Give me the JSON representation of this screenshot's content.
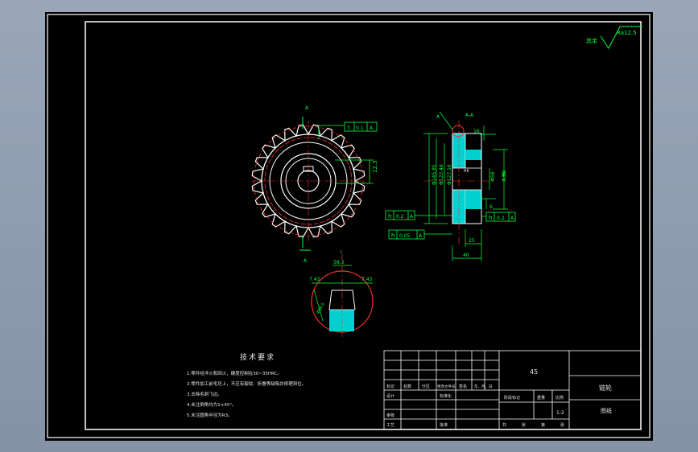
{
  "roughness": {
    "label": "其余",
    "value": "Ra12.5"
  },
  "front_view": {
    "section_label_top": "A",
    "section_label_bottom": "A",
    "tolerance": "t",
    "tol_value": "0.1",
    "tol_datum": "A",
    "dim_right": "12.3"
  },
  "side_view": {
    "section_mark": "A-A",
    "datum_mark": "A",
    "dims": [
      "Φ145.85",
      "Φ122.48",
      "Φ127.16",
      "Φ58",
      "Φ35",
      "16",
      "60",
      "6",
      "25",
      "40",
      "R6"
    ],
    "tol_left_top": {
      "sym": "h",
      "value": "0.2",
      "datum": "A"
    },
    "tol_left_bottom": {
      "sym": "h",
      "value": "0.05",
      "datum": "A"
    },
    "tol_right": {
      "sym": "h",
      "value": "0.2",
      "datum": "A"
    }
  },
  "detail_view": {
    "label": "I",
    "dim_top": "58.3",
    "left": "7.43",
    "right": "7.43",
    "dia": "Φ58.5"
  },
  "tech_req": {
    "title": "技术要求",
    "items": [
      "1.零件经淬火和回火，硬度控制在30~35HRC。",
      "2.零件加工前毛坯上，不应有裂纹、折叠等缺陷并修理到位。",
      "3.去除毛刺飞边。",
      "4.未注倒角均为1×45°。",
      "5.未注圆角半径为R3。"
    ]
  },
  "title_block": {
    "material": "45",
    "part_name": "链轮",
    "drawing_no": "图纸",
    "scale": "1:2",
    "headers": [
      "标记",
      "处数",
      "分区",
      "更改文件号",
      "签名",
      "年、月、日"
    ],
    "row2": [
      "设计",
      "标准化"
    ],
    "stage_labels": [
      "阶段标记",
      "重量",
      "比例"
    ],
    "row_check": "审核",
    "row_process": "工艺",
    "approve": "批准",
    "sheet": [
      "共",
      "张",
      "第",
      "张"
    ]
  }
}
